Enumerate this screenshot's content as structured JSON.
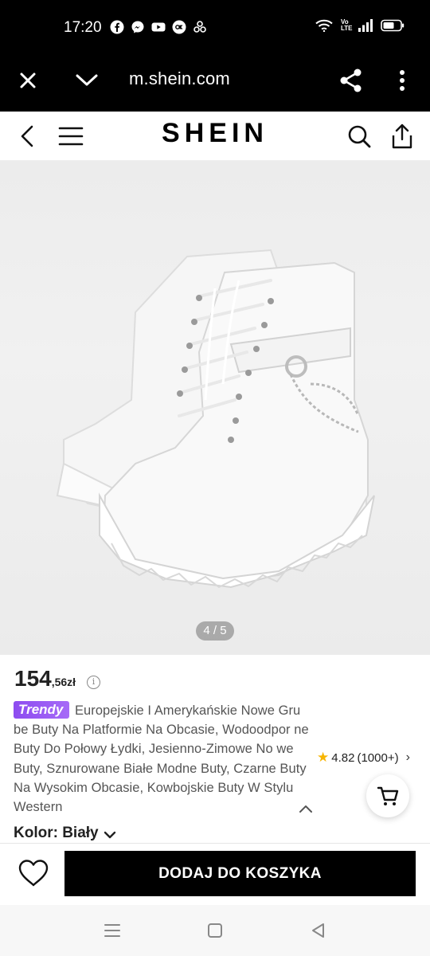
{
  "status_bar": {
    "time": "17:20",
    "app_icons": [
      "facebook-icon",
      "messenger-icon",
      "youtube-icon",
      "okru-icon",
      "app-icon"
    ],
    "network_label": "Vo LTE"
  },
  "browser": {
    "url": "m.shein.com"
  },
  "header": {
    "brand": "SHEIN"
  },
  "gallery": {
    "counter": "4 / 5"
  },
  "product": {
    "price_main": "154",
    "price_decimal": ",56zł",
    "badge": "Trendy",
    "title": "Europejskie I Amerykańskie Nowe Gru be Buty Na Platformie Na Obcasie, Wodoodpor ne Buty Do Połowy Łydki, Jesienno-Zimowe No we Buty, Sznurowane Białe Modne Buty, Czarne Buty Na Wysokim Obcasie, Kowbojskie Buty W Stylu Western",
    "rating": "4.82",
    "rating_count": "(1000+)",
    "color_label": "Kolor: Biały"
  },
  "actions": {
    "add_to_cart": "DODAJ DO KOSZYKA"
  },
  "colors": {
    "badge_purple": "#8d4cf0",
    "star_yellow": "#f7b500",
    "button_black": "#000000"
  }
}
